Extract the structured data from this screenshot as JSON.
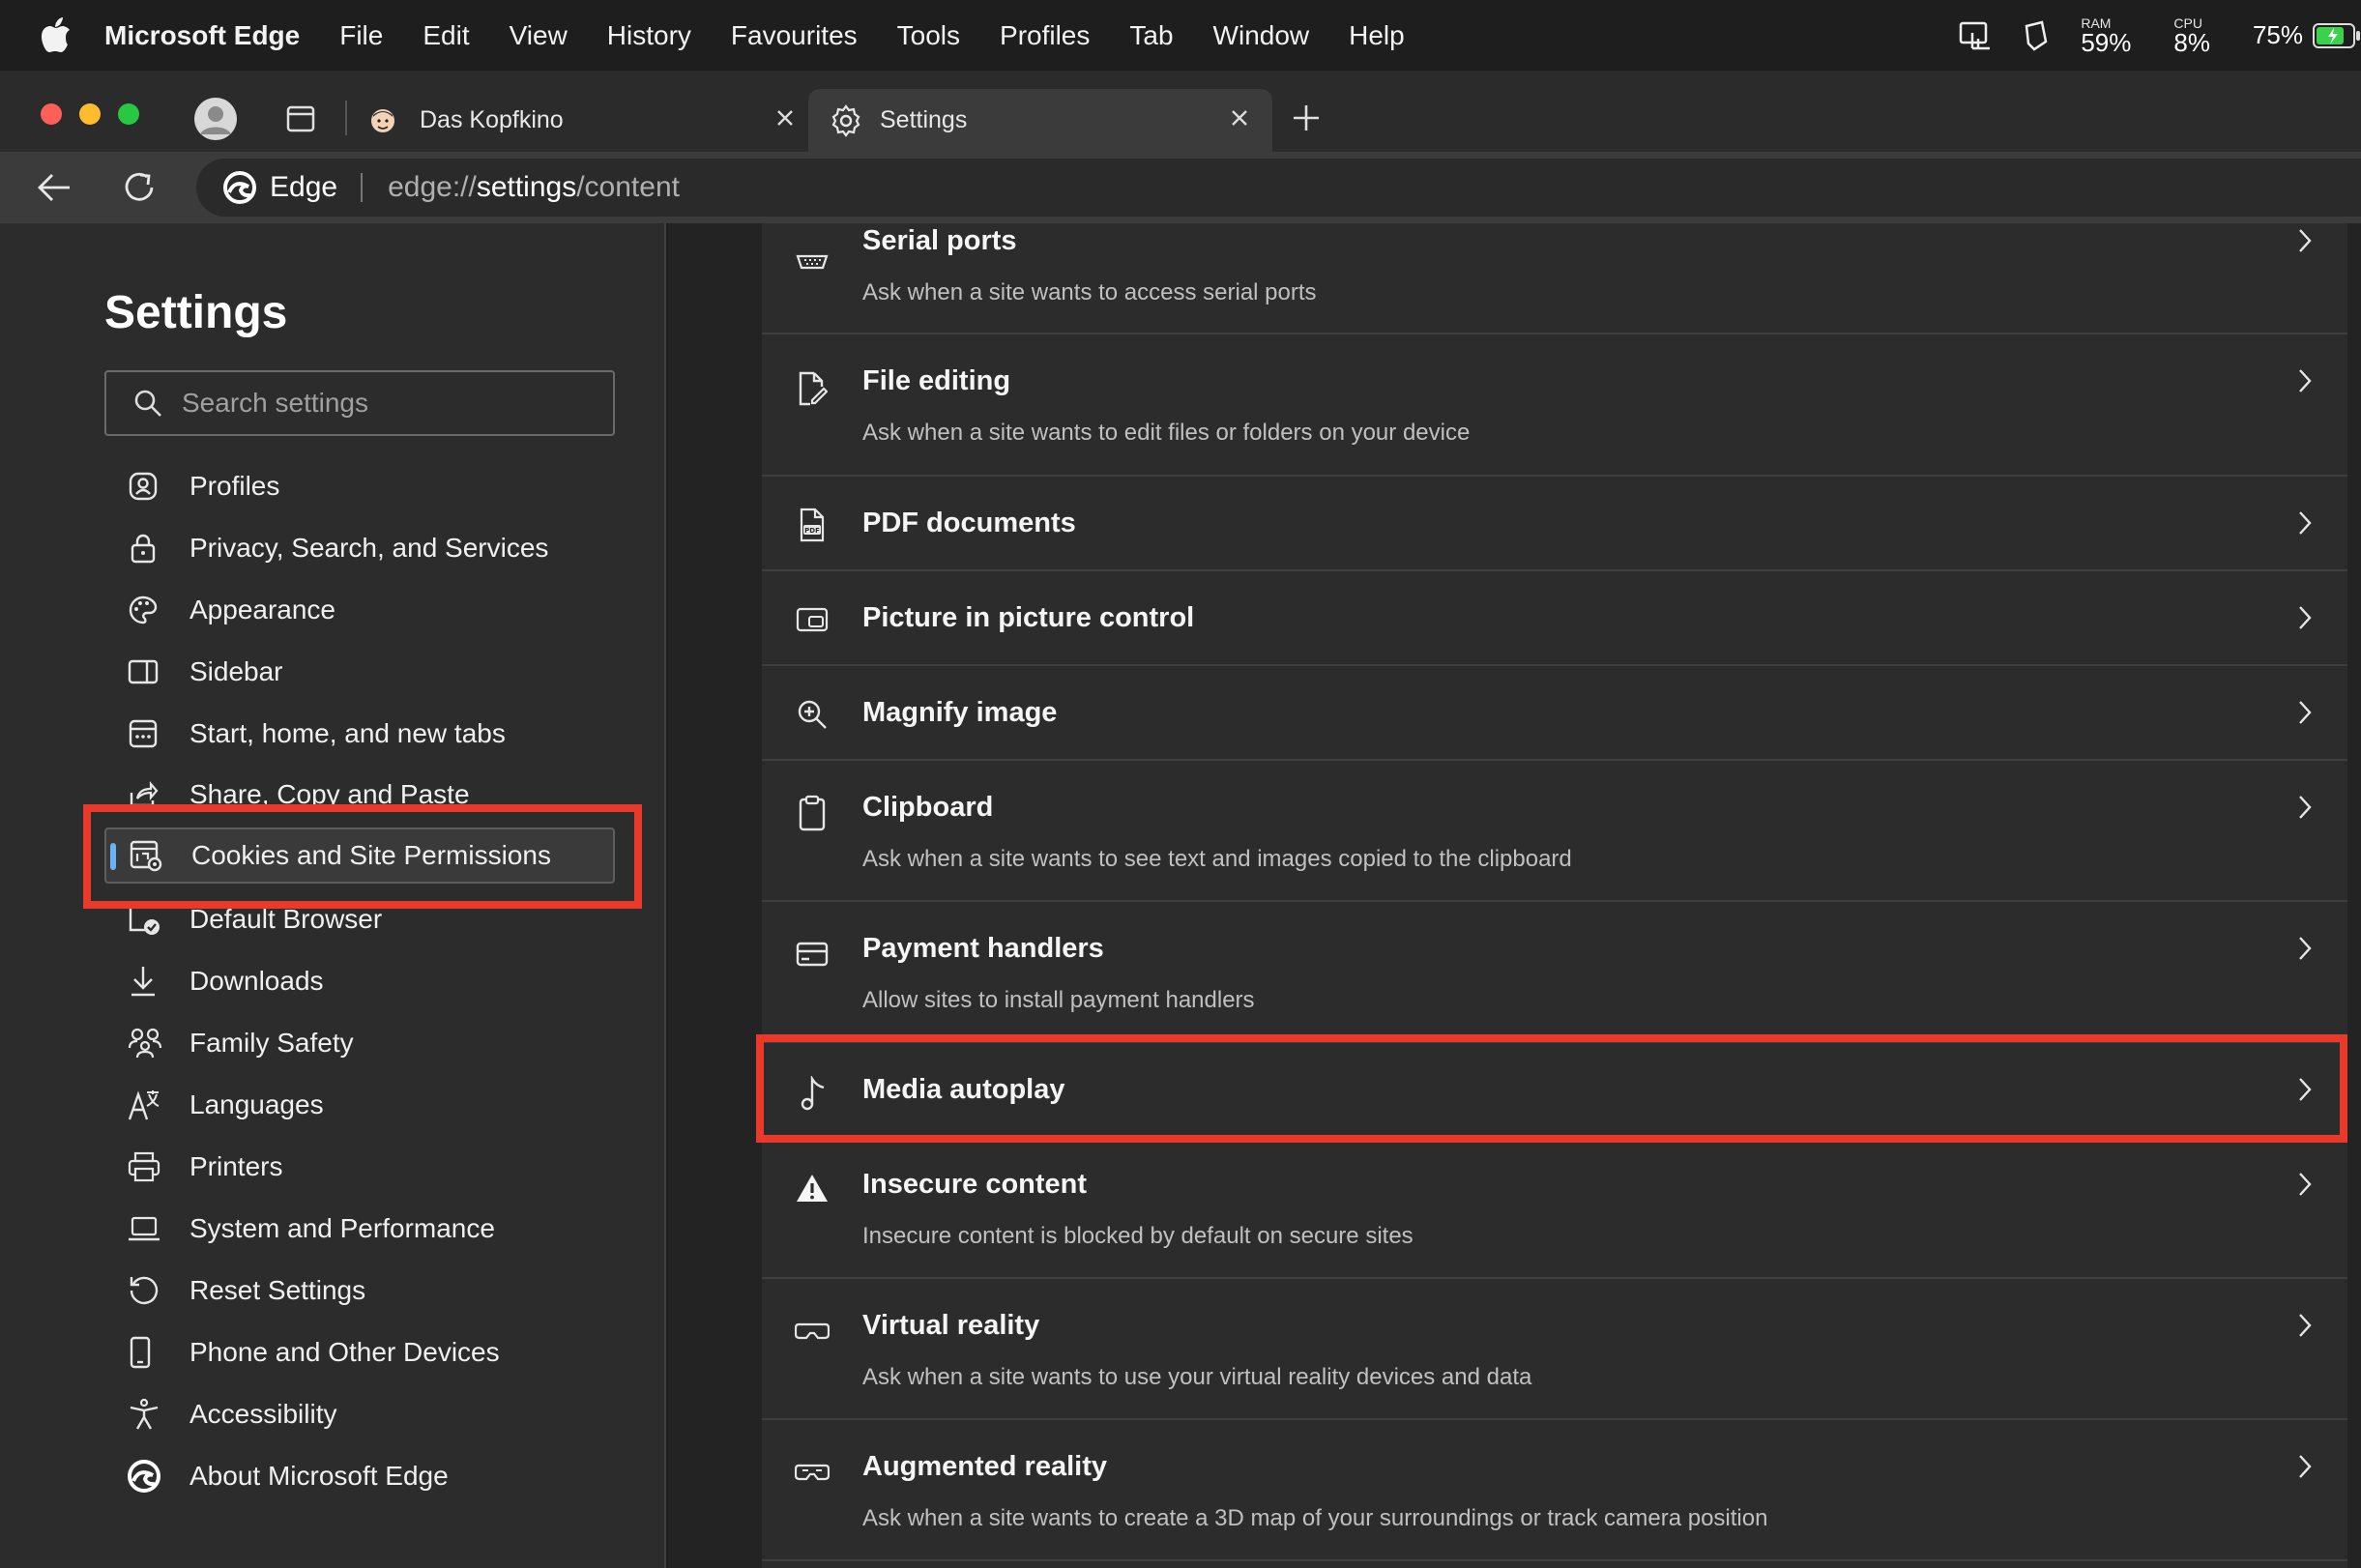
{
  "menubar": {
    "app_name": "Microsoft Edge",
    "items": [
      "File",
      "Edit",
      "View",
      "History",
      "Favourites",
      "Tools",
      "Profiles",
      "Tab",
      "Window",
      "Help"
    ],
    "ram_label": "RAM",
    "ram_value": "59%",
    "cpu_label": "CPU",
    "cpu_value": "8%",
    "battery": "75%"
  },
  "tabs": [
    {
      "title": "Das Kopfkino",
      "active": false
    },
    {
      "title": "Settings",
      "active": true
    }
  ],
  "address": {
    "brand": "Edge",
    "url_prefix": "edge://",
    "url_bold": "settings",
    "url_suffix": "/content"
  },
  "sidebar": {
    "title": "Settings",
    "search_placeholder": "Search settings",
    "items": [
      {
        "label": "Profiles",
        "icon": "profile-icon"
      },
      {
        "label": "Privacy, Search, and Services",
        "icon": "lock-icon"
      },
      {
        "label": "Appearance",
        "icon": "palette-icon"
      },
      {
        "label": "Sidebar",
        "icon": "sidebar-icon"
      },
      {
        "label": "Start, home, and new tabs",
        "icon": "home-tabs-icon"
      },
      {
        "label": "Share, Copy and Paste",
        "icon": "share-icon"
      },
      {
        "label": "Cookies and Site Permissions",
        "icon": "cookies-icon",
        "active": true
      },
      {
        "label": "Default Browser",
        "icon": "default-browser-icon"
      },
      {
        "label": "Downloads",
        "icon": "download-icon"
      },
      {
        "label": "Family Safety",
        "icon": "family-icon"
      },
      {
        "label": "Languages",
        "icon": "languages-icon"
      },
      {
        "label": "Printers",
        "icon": "printer-icon"
      },
      {
        "label": "System and Performance",
        "icon": "laptop-icon"
      },
      {
        "label": "Reset Settings",
        "icon": "reset-icon"
      },
      {
        "label": "Phone and Other Devices",
        "icon": "phone-icon"
      },
      {
        "label": "Accessibility",
        "icon": "accessibility-icon"
      },
      {
        "label": "About Microsoft Edge",
        "icon": "edge-logo-icon"
      }
    ]
  },
  "permissions": [
    {
      "title": "Serial ports",
      "desc": "Ask when a site wants to access serial ports",
      "icon": "serial-port-icon"
    },
    {
      "title": "File editing",
      "desc": "Ask when a site wants to edit files or folders on your device",
      "icon": "file-edit-icon"
    },
    {
      "title": "PDF documents",
      "desc": "",
      "icon": "pdf-icon"
    },
    {
      "title": "Picture in picture control",
      "desc": "",
      "icon": "pip-icon"
    },
    {
      "title": "Magnify image",
      "desc": "",
      "icon": "magnify-icon"
    },
    {
      "title": "Clipboard",
      "desc": "Ask when a site wants to see text and images copied to the clipboard",
      "icon": "clipboard-icon"
    },
    {
      "title": "Payment handlers",
      "desc": "Allow sites to install payment handlers",
      "icon": "payment-icon"
    },
    {
      "title": "Media autoplay",
      "desc": "",
      "icon": "music-note-icon"
    },
    {
      "title": "Insecure content",
      "desc": "Insecure content is blocked by default on secure sites",
      "icon": "warning-icon"
    },
    {
      "title": "Virtual reality",
      "desc": "Ask when a site wants to use your virtual reality devices and data",
      "icon": "vr-headset-icon"
    },
    {
      "title": "Augmented reality",
      "desc": "Ask when a site wants to create a 3D map of your surroundings or track camera position",
      "icon": "ar-headset-icon"
    }
  ],
  "colors": {
    "highlight": "#e8392b",
    "accent": "#6cb0f5"
  }
}
